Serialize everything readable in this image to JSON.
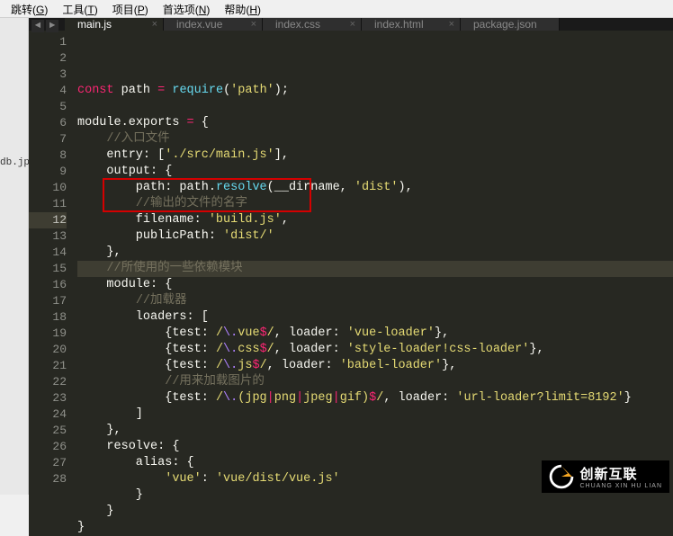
{
  "menubar": {
    "items": [
      {
        "label": "跳转",
        "key": "G"
      },
      {
        "label": "工具",
        "key": "T"
      },
      {
        "label": "项目",
        "key": "P"
      },
      {
        "label": "首选项",
        "key": "N"
      },
      {
        "label": "帮助",
        "key": "H"
      }
    ]
  },
  "sidebar": {
    "file": "db.jpg"
  },
  "tabs": [
    {
      "label": "main.js",
      "active": true
    },
    {
      "label": "index.vue",
      "active": false
    },
    {
      "label": "index.css",
      "active": false
    },
    {
      "label": "index.html",
      "active": false
    },
    {
      "label": "package.json",
      "active": false
    }
  ],
  "code": {
    "lines": [
      {
        "n": 1,
        "tokens": [
          {
            "t": "const",
            "c": "kw-red"
          },
          {
            "t": " path ",
            "c": "plain"
          },
          {
            "t": "=",
            "c": "kw-red"
          },
          {
            "t": " ",
            "c": "plain"
          },
          {
            "t": "require",
            "c": "fn"
          },
          {
            "t": "(",
            "c": "plain"
          },
          {
            "t": "'path'",
            "c": "str"
          },
          {
            "t": ");",
            "c": "plain"
          }
        ]
      },
      {
        "n": 2,
        "tokens": []
      },
      {
        "n": 3,
        "tokens": [
          {
            "t": "module",
            "c": "plain"
          },
          {
            "t": ".",
            "c": "plain"
          },
          {
            "t": "exports",
            "c": "plain"
          },
          {
            "t": " ",
            "c": "plain"
          },
          {
            "t": "=",
            "c": "kw-red"
          },
          {
            "t": " {",
            "c": "plain"
          }
        ]
      },
      {
        "n": 4,
        "tokens": [
          {
            "t": "    ",
            "c": "plain"
          },
          {
            "t": "//入口文件",
            "c": "cmt"
          }
        ]
      },
      {
        "n": 5,
        "tokens": [
          {
            "t": "    entry: [",
            "c": "plain"
          },
          {
            "t": "'./src/main.js'",
            "c": "str"
          },
          {
            "t": "],",
            "c": "plain"
          }
        ]
      },
      {
        "n": 6,
        "tokens": [
          {
            "t": "    output: {",
            "c": "plain"
          }
        ]
      },
      {
        "n": 7,
        "tokens": [
          {
            "t": "        path: path.",
            "c": "plain"
          },
          {
            "t": "resolve",
            "c": "fn"
          },
          {
            "t": "(__dirname, ",
            "c": "plain"
          },
          {
            "t": "'dist'",
            "c": "str"
          },
          {
            "t": "),",
            "c": "plain"
          }
        ]
      },
      {
        "n": 8,
        "tokens": [
          {
            "t": "        ",
            "c": "plain"
          },
          {
            "t": "//输出的文件的名字",
            "c": "cmt"
          }
        ]
      },
      {
        "n": 9,
        "tokens": [
          {
            "t": "        filename: ",
            "c": "plain"
          },
          {
            "t": "'build.js'",
            "c": "str"
          },
          {
            "t": ",",
            "c": "plain"
          }
        ]
      },
      {
        "n": 10,
        "tokens": [
          {
            "t": "        publicPath: ",
            "c": "plain"
          },
          {
            "t": "'dist/'",
            "c": "str"
          }
        ]
      },
      {
        "n": 11,
        "tokens": [
          {
            "t": "    },",
            "c": "plain"
          }
        ]
      },
      {
        "n": 12,
        "highlight": true,
        "tokens": [
          {
            "t": "    ",
            "c": "plain"
          },
          {
            "t": "//所使用的一些依赖模块",
            "c": "cmt"
          }
        ]
      },
      {
        "n": 13,
        "tokens": [
          {
            "t": "    module: {",
            "c": "plain"
          }
        ]
      },
      {
        "n": 14,
        "tokens": [
          {
            "t": "        ",
            "c": "plain"
          },
          {
            "t": "//加载器",
            "c": "cmt"
          }
        ]
      },
      {
        "n": 15,
        "tokens": [
          {
            "t": "        loaders: [",
            "c": "plain"
          }
        ]
      },
      {
        "n": 16,
        "tokens": [
          {
            "t": "            {test: ",
            "c": "plain"
          },
          {
            "t": "/",
            "c": "str"
          },
          {
            "t": "\\.",
            "c": "num"
          },
          {
            "t": "vue",
            "c": "str"
          },
          {
            "t": "$",
            "c": "kw-red"
          },
          {
            "t": "/",
            "c": "str"
          },
          {
            "t": ", loader: ",
            "c": "plain"
          },
          {
            "t": "'vue-loader'",
            "c": "str"
          },
          {
            "t": "},",
            "c": "plain"
          }
        ]
      },
      {
        "n": 17,
        "tokens": [
          {
            "t": "            {test: ",
            "c": "plain"
          },
          {
            "t": "/",
            "c": "str"
          },
          {
            "t": "\\.",
            "c": "num"
          },
          {
            "t": "css",
            "c": "str"
          },
          {
            "t": "$",
            "c": "kw-red"
          },
          {
            "t": "/",
            "c": "str"
          },
          {
            "t": ", loader: ",
            "c": "plain"
          },
          {
            "t": "'style-loader!css-loader'",
            "c": "str"
          },
          {
            "t": "},",
            "c": "plain"
          }
        ]
      },
      {
        "n": 18,
        "tokens": [
          {
            "t": "            {test: ",
            "c": "plain"
          },
          {
            "t": "/",
            "c": "str"
          },
          {
            "t": "\\.",
            "c": "num"
          },
          {
            "t": "js",
            "c": "str"
          },
          {
            "t": "$",
            "c": "kw-red"
          },
          {
            "t": "/",
            "c": "str"
          },
          {
            "t": ", loader: ",
            "c": "plain"
          },
          {
            "t": "'babel-loader'",
            "c": "str"
          },
          {
            "t": "},",
            "c": "plain"
          }
        ]
      },
      {
        "n": 19,
        "tokens": [
          {
            "t": "            ",
            "c": "plain"
          },
          {
            "t": "//用来加载图片的",
            "c": "cmt"
          }
        ]
      },
      {
        "n": 20,
        "tokens": [
          {
            "t": "            {test: ",
            "c": "plain"
          },
          {
            "t": "/",
            "c": "str"
          },
          {
            "t": "\\.",
            "c": "num"
          },
          {
            "t": "(",
            "c": "str"
          },
          {
            "t": "jpg",
            "c": "str"
          },
          {
            "t": "|",
            "c": "kw-red"
          },
          {
            "t": "png",
            "c": "str"
          },
          {
            "t": "|",
            "c": "kw-red"
          },
          {
            "t": "jpeg",
            "c": "str"
          },
          {
            "t": "|",
            "c": "kw-red"
          },
          {
            "t": "gif",
            "c": "str"
          },
          {
            "t": ")",
            "c": "str"
          },
          {
            "t": "$",
            "c": "kw-red"
          },
          {
            "t": "/",
            "c": "str"
          },
          {
            "t": ", loader: ",
            "c": "plain"
          },
          {
            "t": "'url-loader?limit=8192'",
            "c": "str"
          },
          {
            "t": "}",
            "c": "plain"
          }
        ]
      },
      {
        "n": 21,
        "tokens": [
          {
            "t": "        ]",
            "c": "plain"
          }
        ]
      },
      {
        "n": 22,
        "tokens": [
          {
            "t": "    },",
            "c": "plain"
          }
        ]
      },
      {
        "n": 23,
        "tokens": [
          {
            "t": "    resolve: {",
            "c": "plain"
          }
        ]
      },
      {
        "n": 24,
        "tokens": [
          {
            "t": "        alias: {",
            "c": "plain"
          }
        ]
      },
      {
        "n": 25,
        "tokens": [
          {
            "t": "            ",
            "c": "plain"
          },
          {
            "t": "'vue'",
            "c": "str"
          },
          {
            "t": ": ",
            "c": "plain"
          },
          {
            "t": "'vue/dist/vue.js'",
            "c": "str"
          }
        ]
      },
      {
        "n": 26,
        "tokens": [
          {
            "t": "        }",
            "c": "plain"
          }
        ]
      },
      {
        "n": 27,
        "tokens": [
          {
            "t": "    }",
            "c": "plain"
          }
        ]
      },
      {
        "n": 28,
        "tokens": [
          {
            "t": "}",
            "c": "plain"
          }
        ]
      }
    ]
  },
  "logo": {
    "main": "创新互联",
    "sub": "CHUANG XIN HU LIAN"
  }
}
